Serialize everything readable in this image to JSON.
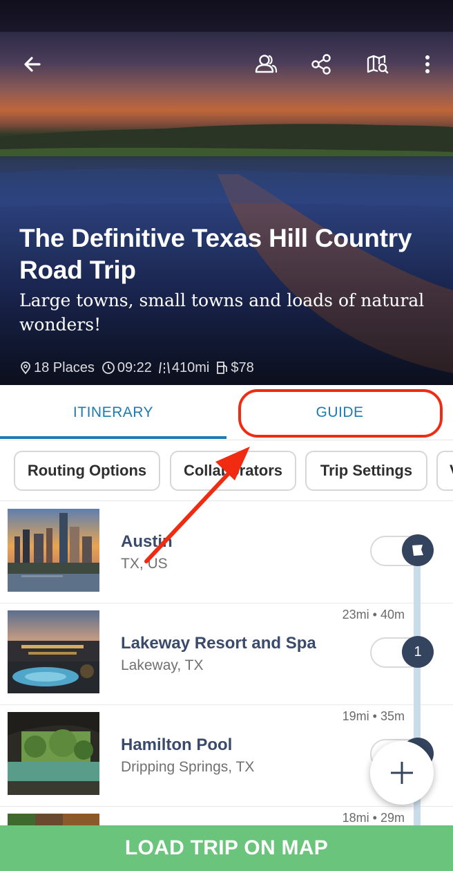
{
  "trip": {
    "title": "The Definitive Texas Hill Country Road Trip",
    "subtitle": "Large towns, small towns and loads of natural wonders!",
    "stats": {
      "places": "18 Places",
      "duration": "09:22",
      "distance": "410mi",
      "cost": "$78"
    }
  },
  "toolbar": {
    "back_icon": "arrow-left-icon",
    "collaborators_icon": "people-icon",
    "share_icon": "share-icon",
    "map_search_icon": "map-search-icon",
    "more_icon": "more-vertical-icon"
  },
  "tabs": [
    {
      "label": "ITINERARY",
      "active": true
    },
    {
      "label": "GUIDE",
      "active": false
    }
  ],
  "chips": [
    {
      "label": "Routing Options"
    },
    {
      "label": "Collaborators"
    },
    {
      "label": "Trip Settings"
    },
    {
      "label": "V"
    }
  ],
  "stops": [
    {
      "name": "Austin",
      "location": "TX, US",
      "distance": "",
      "marker": "flag"
    },
    {
      "name": "Lakeway Resort and Spa",
      "location": "Lakeway, TX",
      "distance": "23mi • 40m",
      "marker": "1"
    },
    {
      "name": "Hamilton Pool",
      "location": "Dripping Springs, TX",
      "distance": "19mi • 35m",
      "marker": "2"
    },
    {
      "name": "",
      "location": "",
      "distance": "18mi • 29m",
      "marker": ""
    }
  ],
  "actions": {
    "add_icon": "plus-icon",
    "load_label": "LOAD TRIP ON MAP"
  },
  "colors": {
    "accent": "#1b7bb0",
    "highlight": "#f02b12",
    "cta": "#6bc47b",
    "node": "#34445e"
  }
}
